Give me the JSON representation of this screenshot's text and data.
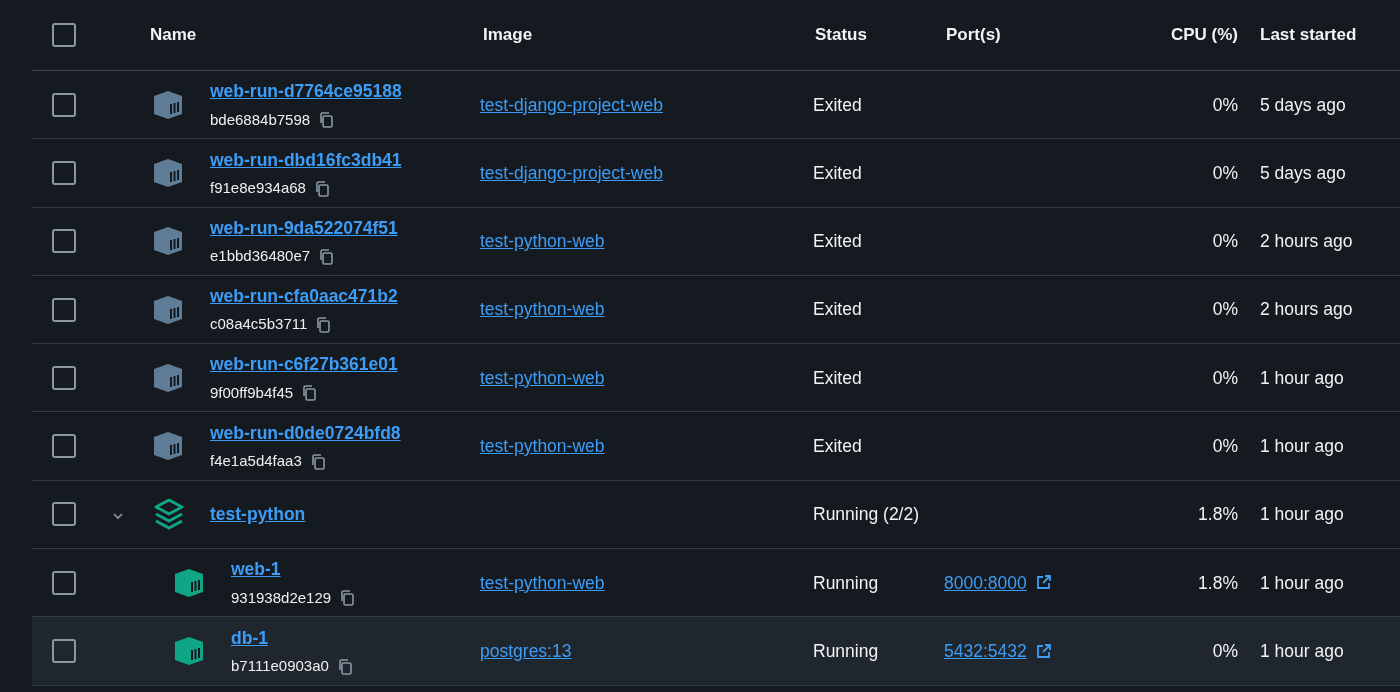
{
  "columns": [
    "Name",
    "Image",
    "Status",
    "Port(s)",
    "CPU (%)",
    "Last started"
  ],
  "header_checkbox": {
    "checked": false
  },
  "rows": [
    {
      "kind": "container",
      "name": "web-run-d7764ce95188",
      "id": "bde6884b7598",
      "image": "test-django-project-web",
      "status": "Exited",
      "running": false,
      "cpu": "0%",
      "last_started": "5 days ago",
      "checked": false,
      "hovered": false
    },
    {
      "kind": "container",
      "name": "web-run-dbd16fc3db41",
      "id": "f91e8e934a68",
      "image": "test-django-project-web",
      "status": "Exited",
      "running": false,
      "cpu": "0%",
      "last_started": "5 days ago",
      "checked": false,
      "hovered": false
    },
    {
      "kind": "container",
      "name": "web-run-9da522074f51",
      "id": "e1bbd36480e7",
      "image": "test-python-web",
      "status": "Exited",
      "running": false,
      "cpu": "0%",
      "last_started": "2 hours ago",
      "checked": false,
      "hovered": false
    },
    {
      "kind": "container",
      "name": "web-run-cfa0aac471b2",
      "id": "c08a4c5b3711",
      "image": "test-python-web",
      "status": "Exited",
      "running": false,
      "cpu": "0%",
      "last_started": "2 hours ago",
      "checked": false,
      "hovered": false
    },
    {
      "kind": "container",
      "name": "web-run-c6f27b361e01",
      "id": "9f00ff9b4f45",
      "image": "test-python-web",
      "status": "Exited",
      "running": false,
      "cpu": "0%",
      "last_started": "1 hour ago",
      "checked": false,
      "hovered": false
    },
    {
      "kind": "container",
      "name": "web-run-d0de0724bfd8",
      "id": "f4e1a5d4faa3",
      "image": "test-python-web",
      "status": "Exited",
      "running": false,
      "cpu": "0%",
      "last_started": "1 hour ago",
      "checked": false,
      "hovered": false
    },
    {
      "kind": "stack",
      "name": "test-python",
      "status": "Running (2/2)",
      "running": true,
      "cpu": "1.8%",
      "last_started": "1 hour ago",
      "checked": false,
      "hovered": false,
      "expanded": true,
      "children": [
        {
          "kind": "container",
          "name": "web-1",
          "id": "931938d2e129",
          "image": "test-python-web",
          "status": "Running",
          "running": true,
          "port": "8000:8000",
          "cpu": "1.8%",
          "last_started": "1 hour ago",
          "checked": false,
          "hovered": false
        },
        {
          "kind": "container",
          "name": "db-1",
          "id": "b7111e0903a0",
          "image": "postgres:13",
          "status": "Running",
          "running": true,
          "port": "5432:5432",
          "cpu": "0%",
          "last_started": "1 hour ago",
          "checked": false,
          "hovered": true
        }
      ]
    }
  ]
}
